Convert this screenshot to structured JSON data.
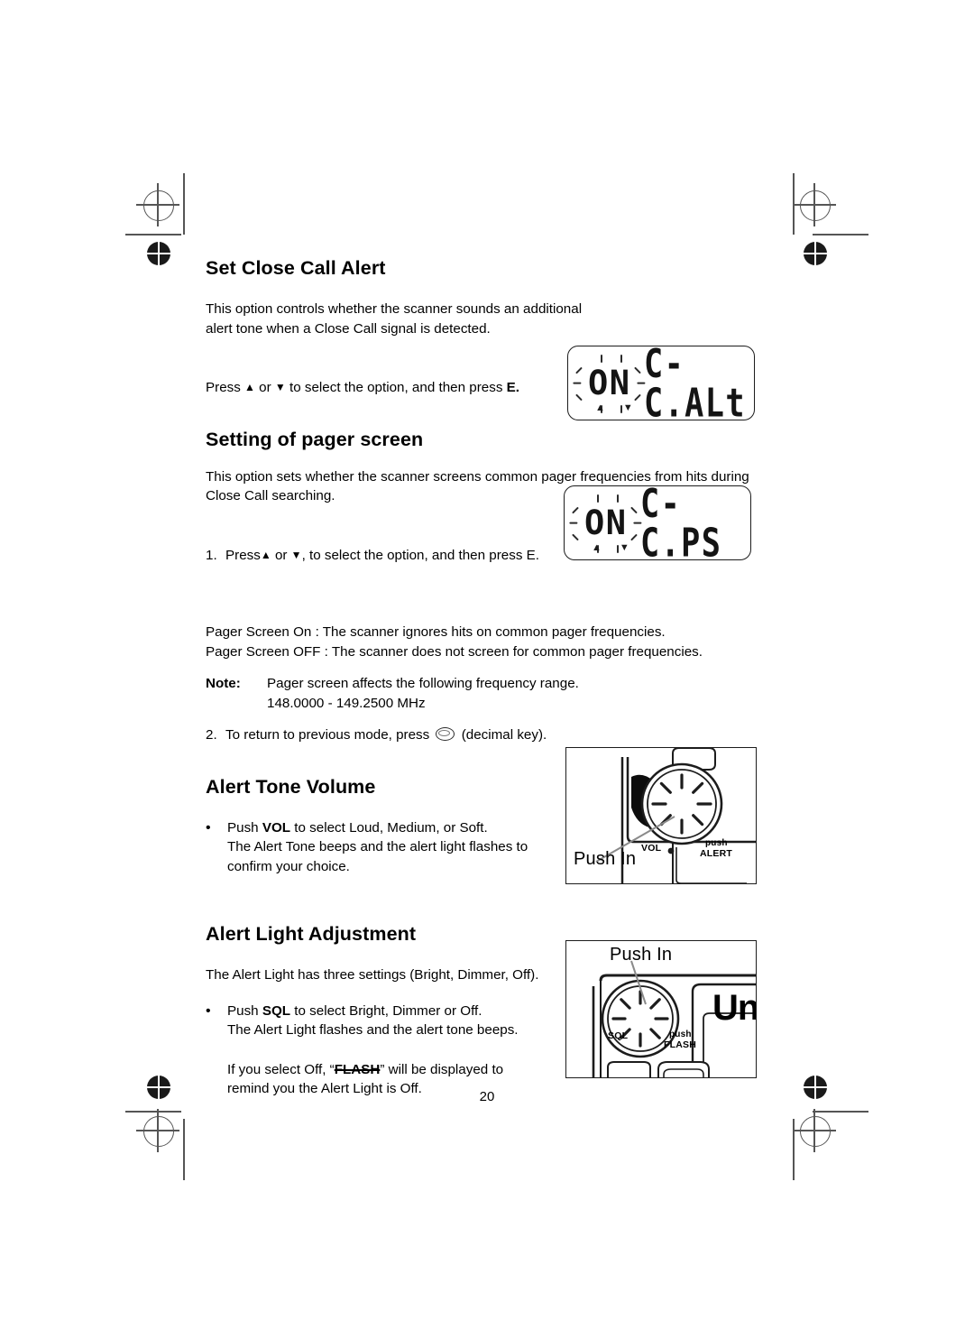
{
  "page": {
    "number": "20"
  },
  "sections": {
    "close_call_alert": {
      "title": "Set Close Call Alert",
      "body": "This option controls whether the scanner sounds an additional alert tone when a Close Call signal is detected.",
      "instruction_pre": "Press ",
      "instruction_mid": " or ",
      "instruction_post": " to select the option, and then press ",
      "instruction_key": "E.",
      "arrow_up": "▲",
      "arrow_down": "▼"
    },
    "pager_screen": {
      "title": "Setting of pager screen",
      "body": "This option sets whether the scanner screens common pager frequencies from hits during Close Call searching.",
      "step1_marker": "1.",
      "step1_pre": "Press",
      "step1_mid": " or ",
      "step1_post": ", to select the option, and then press E.",
      "on_line": "Pager Screen On : The scanner ignores hits on common pager frequencies.",
      "off_line": "Pager Screen OFF : The scanner does not screen for common pager frequencies.",
      "note_label": "Note:",
      "note_line1": "Pager screen affects the following frequency range.",
      "note_line2": "148.0000 - 149.2500 MHz",
      "step2_marker": "2.",
      "step2_pre": "To return to previous mode, press",
      "step2_post": "(decimal key)."
    },
    "alert_tone_volume": {
      "title": "Alert Tone Volume",
      "bullet": "•",
      "line1_pre": "Push  ",
      "line1_key": "VOL",
      "line1_post": " to select Loud, Medium, or Soft.",
      "line2": "The Alert Tone beeps and the alert light flashes to",
      "line3": "confirm your choice."
    },
    "alert_light_adjustment": {
      "title": "Alert Light Adjustment",
      "body": "The Alert Light has three settings (Bright, Dimmer, Off).",
      "bullet": "•",
      "b_line1_pre": "Push ",
      "b_line1_key": "SQL",
      "b_line1_post": " to select Bright, Dimmer or Off.",
      "b_line2": "The Alert Light flashes and the alert tone beeps.",
      "p2_pre": "If you select Off,  “",
      "p2_flash": "FLASH",
      "p2_post": "” will be displayed to",
      "p2_line2": "remind you the Alert Light is Off."
    }
  },
  "lcd_displays": [
    {
      "name": "close-call-alert-display",
      "flashing_value": "ON",
      "code": "C-C.ALt"
    },
    {
      "name": "pager-screen-display",
      "flashing_value": "ON",
      "code": "C-C.PS"
    }
  ],
  "illustrations": {
    "vol_knob": {
      "callout": "Push In",
      "left_label": "VOL",
      "right_label_top": "push",
      "right_label_bottom": "ALERT"
    },
    "sql_knob": {
      "callout": "Push In",
      "left_label": "SQL",
      "right_label_top": "push",
      "right_label_bottom": "FLASH",
      "brand": "Uni"
    }
  }
}
